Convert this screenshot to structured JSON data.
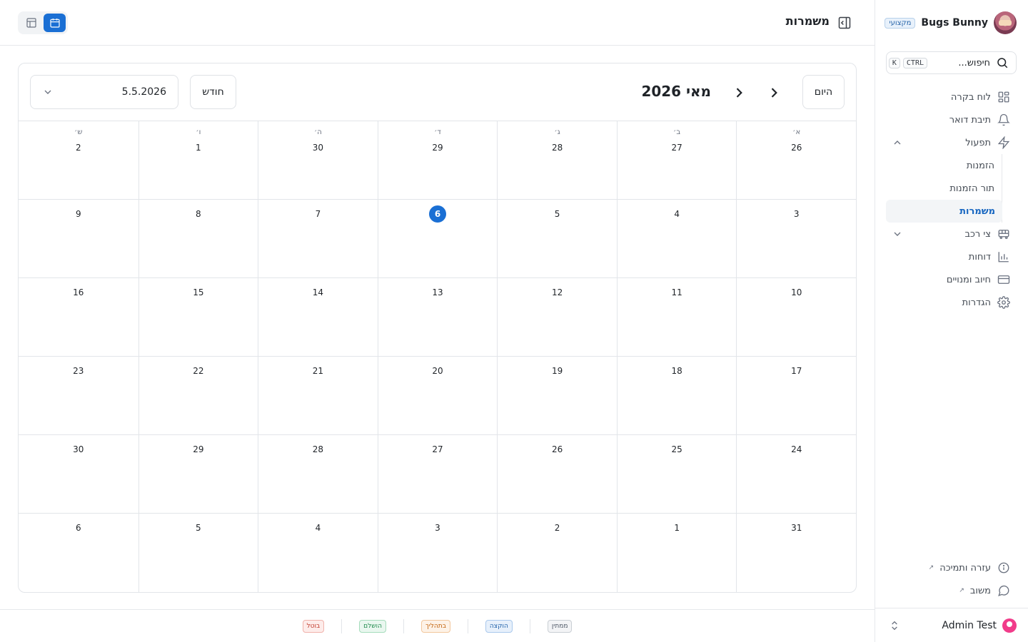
{
  "sidebar": {
    "org_name": "Bugs Bunny",
    "org_badge": "מקצועי",
    "search": {
      "placeholder": "חיפוש...",
      "kbd_ctrl": "CTRL",
      "kbd_k": "K"
    },
    "nav": {
      "dashboard": "לוח בקרה",
      "inbox": "תיבת דואר",
      "operations": "תפעול",
      "orders": "הזמנות",
      "orders_queue": "תור הזמנות",
      "shifts": "משמרות",
      "fleet": "צי רכב",
      "reports": "דוחות",
      "billing": "חיוב ומנויים",
      "settings": "הגדרות"
    },
    "help": "עזרה ותמיכה",
    "feedback": "משוב",
    "user_name": "Admin Test"
  },
  "topbar": {
    "title": "משמרות"
  },
  "calendar": {
    "today_label": "היום",
    "month_title": "מאי 2026",
    "view_label": "חודש",
    "selected_date": "5.5.2026",
    "weekdays": [
      "א׳",
      "ב׳",
      "ג׳",
      "ד׳",
      "ה׳",
      "ו׳",
      "ש׳"
    ],
    "weeks": [
      [
        "26",
        "27",
        "28",
        "29",
        "30",
        "1",
        "2"
      ],
      [
        "3",
        "4",
        "5",
        "6",
        "7",
        "8",
        "9"
      ],
      [
        "10",
        "11",
        "12",
        "13",
        "14",
        "15",
        "16"
      ],
      [
        "17",
        "18",
        "19",
        "20",
        "21",
        "22",
        "23"
      ],
      [
        "24",
        "25",
        "26",
        "27",
        "28",
        "29",
        "30"
      ],
      [
        "31",
        "1",
        "2",
        "3",
        "4",
        "5",
        "6"
      ]
    ],
    "today_cell": "6"
  },
  "legend": [
    {
      "label": "ממתין",
      "color": "#4b5563",
      "bg": "#f3f4f6",
      "border": "#c9ced4"
    },
    {
      "label": "הוקצה",
      "color": "#1d5fa8",
      "bg": "#e7f0fb",
      "border": "#a9c8ec"
    },
    {
      "label": "בתהליך",
      "color": "#c2620c",
      "bg": "#fdf2e7",
      "border": "#f2c79c"
    },
    {
      "label": "הושלם",
      "color": "#1f8a4c",
      "bg": "#e9f7ef",
      "border": "#a5dcbb"
    },
    {
      "label": "בוטל",
      "color": "#c0392b",
      "bg": "#fdecea",
      "border": "#f0b2ab"
    }
  ]
}
